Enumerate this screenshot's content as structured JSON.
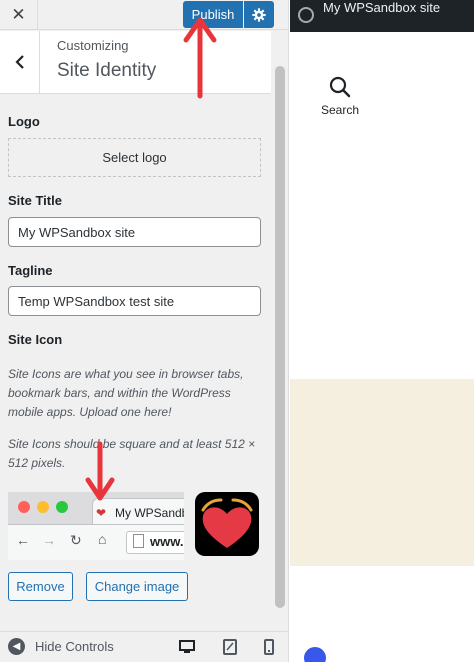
{
  "topbar": {
    "close_label": "✕",
    "publish_label": "Publish"
  },
  "section": {
    "eyebrow": "Customizing",
    "title": "Site Identity"
  },
  "logo": {
    "label": "Logo",
    "select_label": "Select logo"
  },
  "site_title": {
    "label": "Site Title",
    "value": "My WPSandbox site"
  },
  "tagline": {
    "label": "Tagline",
    "value": "Temp WPSandbox test site"
  },
  "site_icon": {
    "label": "Site Icon",
    "description": "Site Icons are what you see in browser tabs, bookmark bars, and within the WordPress mobile apps. Upload one here!",
    "size_note": "Site Icons should be square and at least 512 × 512 pixels.",
    "preview_tab_title": "My WPSandb",
    "preview_url": "www.",
    "remove_label": "Remove",
    "change_label": "Change image"
  },
  "footer": {
    "hide_controls_label": "Hide Controls",
    "devices": [
      "desktop-icon",
      "tablet-icon",
      "mobile-icon"
    ]
  },
  "preview": {
    "admin_site_name": "My WPSandbox site",
    "search_label": "Search"
  },
  "colors": {
    "accent": "#2271b1",
    "admin_bar": "#1d2327",
    "annotation_arrow": "#e8353b",
    "beige_block": "#f5efe0"
  }
}
